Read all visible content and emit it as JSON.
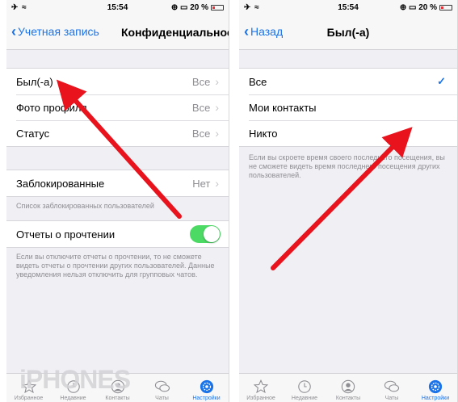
{
  "left": {
    "status": {
      "signal": "✈ ≈",
      "time": "15:54",
      "right": "⊕ ▭ 20 %"
    },
    "nav": {
      "back_label": "Учетная запись",
      "title": "Конфиденциальность"
    },
    "group1": [
      {
        "label": "Был(-а)",
        "value": "Все"
      },
      {
        "label": "Фото профиля",
        "value": "Все"
      },
      {
        "label": "Статус",
        "value": "Все"
      }
    ],
    "blocked": {
      "label": "Заблокированные",
      "value": "Нет",
      "footnote": "Список заблокированных пользователей"
    },
    "receipts": {
      "label": "Отчеты о прочтении",
      "enabled": true,
      "footnote": "Если вы отключите отчеты о прочтении, то не сможете видеть отчеты о прочтении других пользователей. Данные уведомления нельзя отключить для групповых чатов."
    },
    "tabs": [
      {
        "label": "Избранное",
        "icon": "star-icon"
      },
      {
        "label": "Недавние",
        "icon": "clock-icon"
      },
      {
        "label": "Контакты",
        "icon": "person-icon"
      },
      {
        "label": "Чаты",
        "icon": "chat-icon"
      },
      {
        "label": "Настройки",
        "icon": "settings-icon"
      }
    ],
    "watermark": "iPHONES"
  },
  "right": {
    "status": {
      "signal": "✈ ≈",
      "time": "15:54",
      "right": "⊕ ▭ 20 %"
    },
    "nav": {
      "back_label": "Назад",
      "title": "Был(-а)"
    },
    "options": [
      {
        "label": "Все",
        "selected": true
      },
      {
        "label": "Мои контакты",
        "selected": false
      },
      {
        "label": "Никто",
        "selected": false
      }
    ],
    "footnote": "Если вы скроете время своего последнего посещения, вы не сможете видеть время последнего посещения других пользователей.",
    "tabs": [
      {
        "label": "Избранное",
        "icon": "star-icon"
      },
      {
        "label": "Недавние",
        "icon": "clock-icon"
      },
      {
        "label": "Контакты",
        "icon": "person-icon"
      },
      {
        "label": "Чаты",
        "icon": "chat-icon"
      },
      {
        "label": "Настройки",
        "icon": "settings-icon"
      }
    ]
  },
  "colors": {
    "accent": "#1a73e8",
    "toggle_on": "#4cd964",
    "arrow": "#e8131c"
  }
}
